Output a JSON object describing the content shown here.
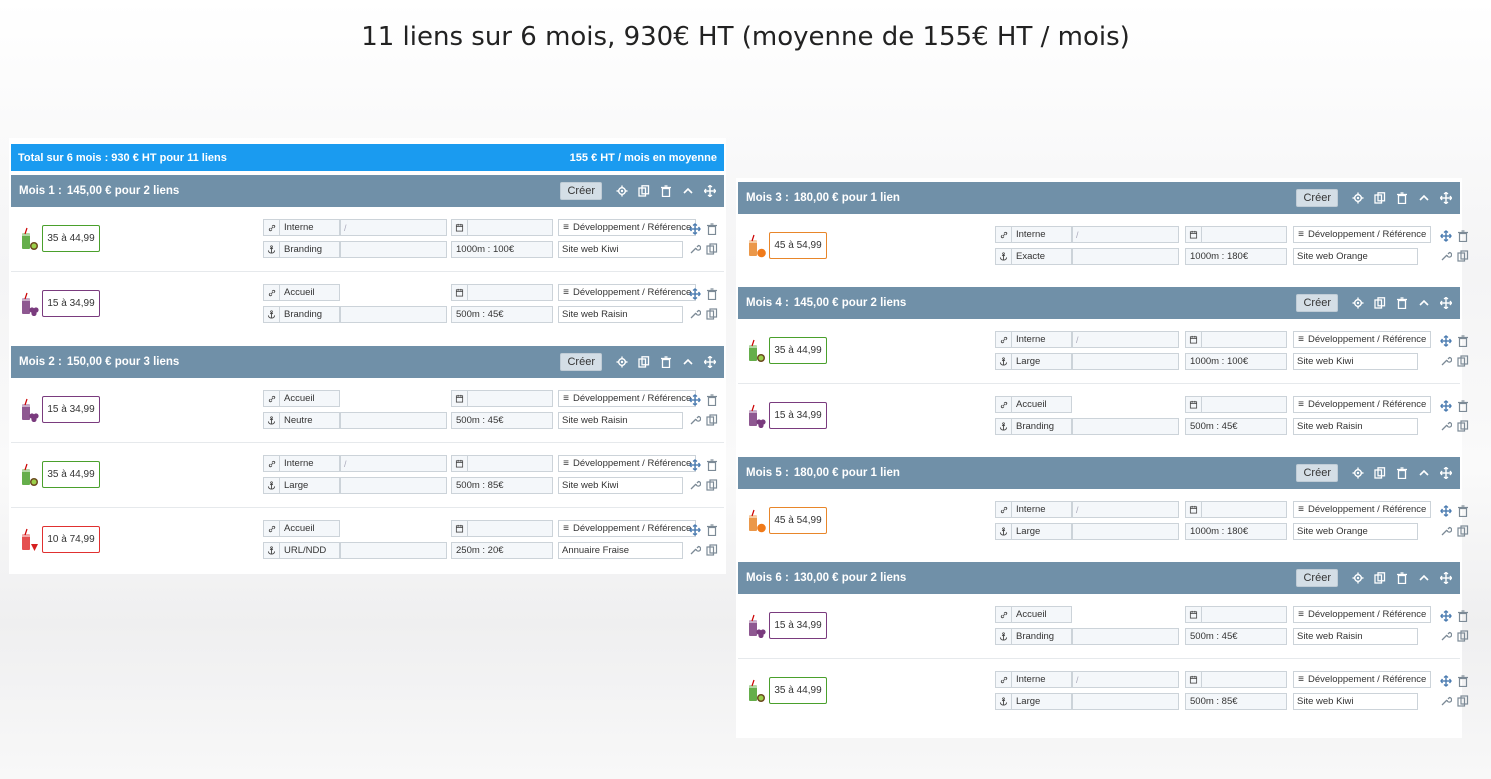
{
  "title": "11 liens sur 6 mois, 930€ HT (moyenne de 155€ HT / mois)",
  "total": {
    "left": "Total sur 6 mois : 930 € HT pour 11 liens",
    "right": "155 € HT / mois en moyenne"
  },
  "create_label": "Créer",
  "category_label": "Développement / Référence",
  "colors": {
    "kiwi": "#4aa02c",
    "raisin": "#7a3b7e",
    "orange": "#e8862a",
    "fraise": "#e03030",
    "header": "#7090a8",
    "total": "#1a9bf0"
  },
  "months": [
    {
      "name": "Mois 1 :",
      "summary": "145,00 € pour 2 liens",
      "links": [
        {
          "fruit": "kiwi",
          "price": "35 à 44,99",
          "page": "Interne",
          "anchor": "Branding",
          "power": "1000m : 100€",
          "site": "Site web Kiwi"
        },
        {
          "fruit": "raisin",
          "price": "15 à 34,99",
          "page": "Accueil",
          "anchor": "Branding",
          "power": "500m : 45€",
          "site": "Site web Raisin"
        }
      ]
    },
    {
      "name": "Mois 2 :",
      "summary": "150,00 € pour 3 liens",
      "links": [
        {
          "fruit": "raisin",
          "price": "15 à 34,99",
          "page": "Accueil",
          "anchor": "Neutre",
          "power": "500m : 45€",
          "site": "Site web Raisin"
        },
        {
          "fruit": "kiwi",
          "price": "35 à 44,99",
          "page": "Interne",
          "anchor": "Large",
          "power": "500m : 85€",
          "site": "Site web Kiwi"
        },
        {
          "fruit": "fraise",
          "price": "10 à 74,99",
          "page": "Accueil",
          "anchor": "URL/NDD",
          "power": "250m : 20€",
          "site": "Annuaire Fraise"
        }
      ]
    },
    {
      "name": "Mois 3 :",
      "summary": "180,00 € pour 1 lien",
      "links": [
        {
          "fruit": "orange",
          "price": "45 à 54,99",
          "page": "Interne",
          "anchor": "Exacte",
          "power": "1000m : 180€",
          "site": "Site web Orange"
        }
      ]
    },
    {
      "name": "Mois 4 :",
      "summary": "145,00 € pour 2 liens",
      "links": [
        {
          "fruit": "kiwi",
          "price": "35 à 44,99",
          "page": "Interne",
          "anchor": "Large",
          "power": "1000m : 100€",
          "site": "Site web Kiwi"
        },
        {
          "fruit": "raisin",
          "price": "15 à 34,99",
          "page": "Accueil",
          "anchor": "Branding",
          "power": "500m : 45€",
          "site": "Site web Raisin"
        }
      ]
    },
    {
      "name": "Mois 5 :",
      "summary": "180,00 € pour 1 lien",
      "links": [
        {
          "fruit": "orange",
          "price": "45 à 54,99",
          "page": "Interne",
          "anchor": "Large",
          "power": "1000m : 180€",
          "site": "Site web Orange"
        }
      ]
    },
    {
      "name": "Mois 6 :",
      "summary": "130,00 € pour 2 liens",
      "links": [
        {
          "fruit": "raisin",
          "price": "15 à 34,99",
          "page": "Accueil",
          "anchor": "Branding",
          "power": "500m : 45€",
          "site": "Site web Raisin"
        },
        {
          "fruit": "kiwi",
          "price": "35 à 44,99",
          "page": "Interne",
          "anchor": "Large",
          "power": "500m : 85€",
          "site": "Site web Kiwi"
        }
      ]
    }
  ]
}
